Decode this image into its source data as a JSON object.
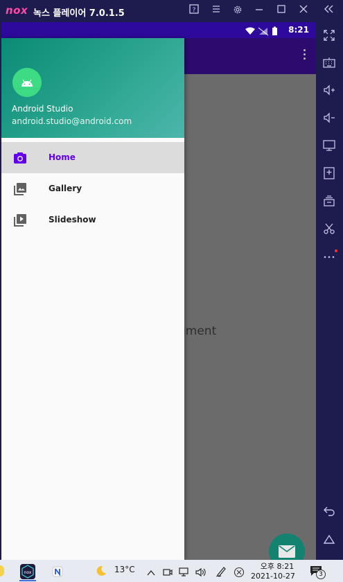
{
  "window": {
    "logo": "nox",
    "title": "녹스 플레이어 7.0.1.5",
    "buttons": [
      "help-icon",
      "menu-icon",
      "settings-icon",
      "minimize-icon",
      "maximize-icon",
      "close-icon",
      "collapse-icon"
    ]
  },
  "android": {
    "status_time": "8:21",
    "content_text": "gment",
    "drawer": {
      "name": "Android Studio",
      "email": "android.studio@android.com",
      "items": [
        {
          "label": "Home",
          "icon": "camera-icon",
          "active": true
        },
        {
          "label": "Gallery",
          "icon": "gallery-icon",
          "active": false
        },
        {
          "label": "Slideshow",
          "icon": "slideshow-icon",
          "active": false
        }
      ]
    },
    "accent_color": "#6200ee",
    "header_color": "#0a8a74"
  },
  "nox_sidebar": [
    "fullscreen-icon",
    "keyboard-icon",
    "volume-up-icon",
    "volume-down-icon",
    "screen-icon",
    "apk-icon",
    "multi-instance-icon",
    "scissors-icon",
    "more-icon",
    "back-icon",
    "home-icon"
  ],
  "taskbar": {
    "weather_temp": "13°C",
    "clock_period_time": "오후 8:21",
    "date": "2021-10-27",
    "notifications_count": "3"
  }
}
